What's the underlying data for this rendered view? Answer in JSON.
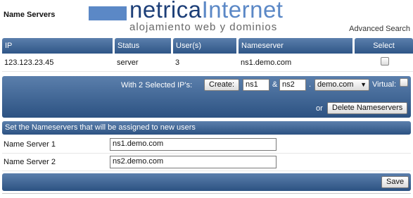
{
  "header": {
    "page_title": "Name Servers",
    "logo_main_a": "netrica",
    "logo_main_b": "Internet",
    "logo_sub": "alojamiento web y dominios",
    "advanced_search": "Advanced Search"
  },
  "table": {
    "columns": [
      "IP",
      "Status",
      "User(s)",
      "Nameserver",
      "Select"
    ],
    "rows": [
      {
        "ip": "123.123.23.45",
        "status": "server",
        "users": "3",
        "nameserver": "ns1.demo.com",
        "selected": false
      }
    ]
  },
  "action_bar": {
    "label": "With 2 Selected IP's:",
    "create_label": "Create:",
    "ns1_value": "ns1",
    "amp": "&",
    "ns2_value": "ns2",
    "dot": ".",
    "domain_value": "demo.com",
    "virtual_label": "Virtual:",
    "virtual_checked": false,
    "or_label": "or",
    "delete_label": "Delete Nameservers"
  },
  "new_users": {
    "title": "Set the Nameservers that will be assigned to new users",
    "ns1_label": "Name Server 1",
    "ns1_value": "ns1.demo.com",
    "ns2_label": "Name Server 2",
    "ns2_value": "ns2.demo.com",
    "save_label": "Save"
  },
  "colors": {
    "bar_top": "#5b7fac",
    "bar_bottom": "#2c5282",
    "logo_dark": "#1d3f78",
    "logo_light": "#5b88c6"
  }
}
